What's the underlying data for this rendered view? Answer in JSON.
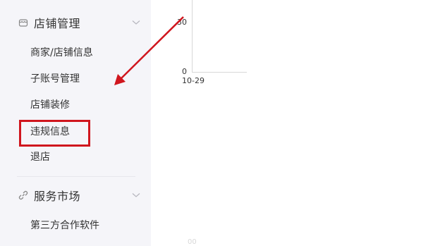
{
  "sidebar": {
    "groups": [
      {
        "title": "店铺管理",
        "icon": "store-icon",
        "items": [
          "商家/店铺信息",
          "子账号管理",
          "店铺装修",
          "违规信息",
          "退店"
        ]
      },
      {
        "title": "服务市场",
        "icon": "link-icon",
        "items": [
          "第三方合作软件"
        ]
      }
    ],
    "highlighted_item": "违规信息"
  },
  "chart": {
    "y_ticks": [
      "30",
      "0"
    ],
    "x_ticks": [
      "10-29"
    ],
    "faint_label": "00"
  },
  "annotation": {
    "color": "#d0161e"
  }
}
